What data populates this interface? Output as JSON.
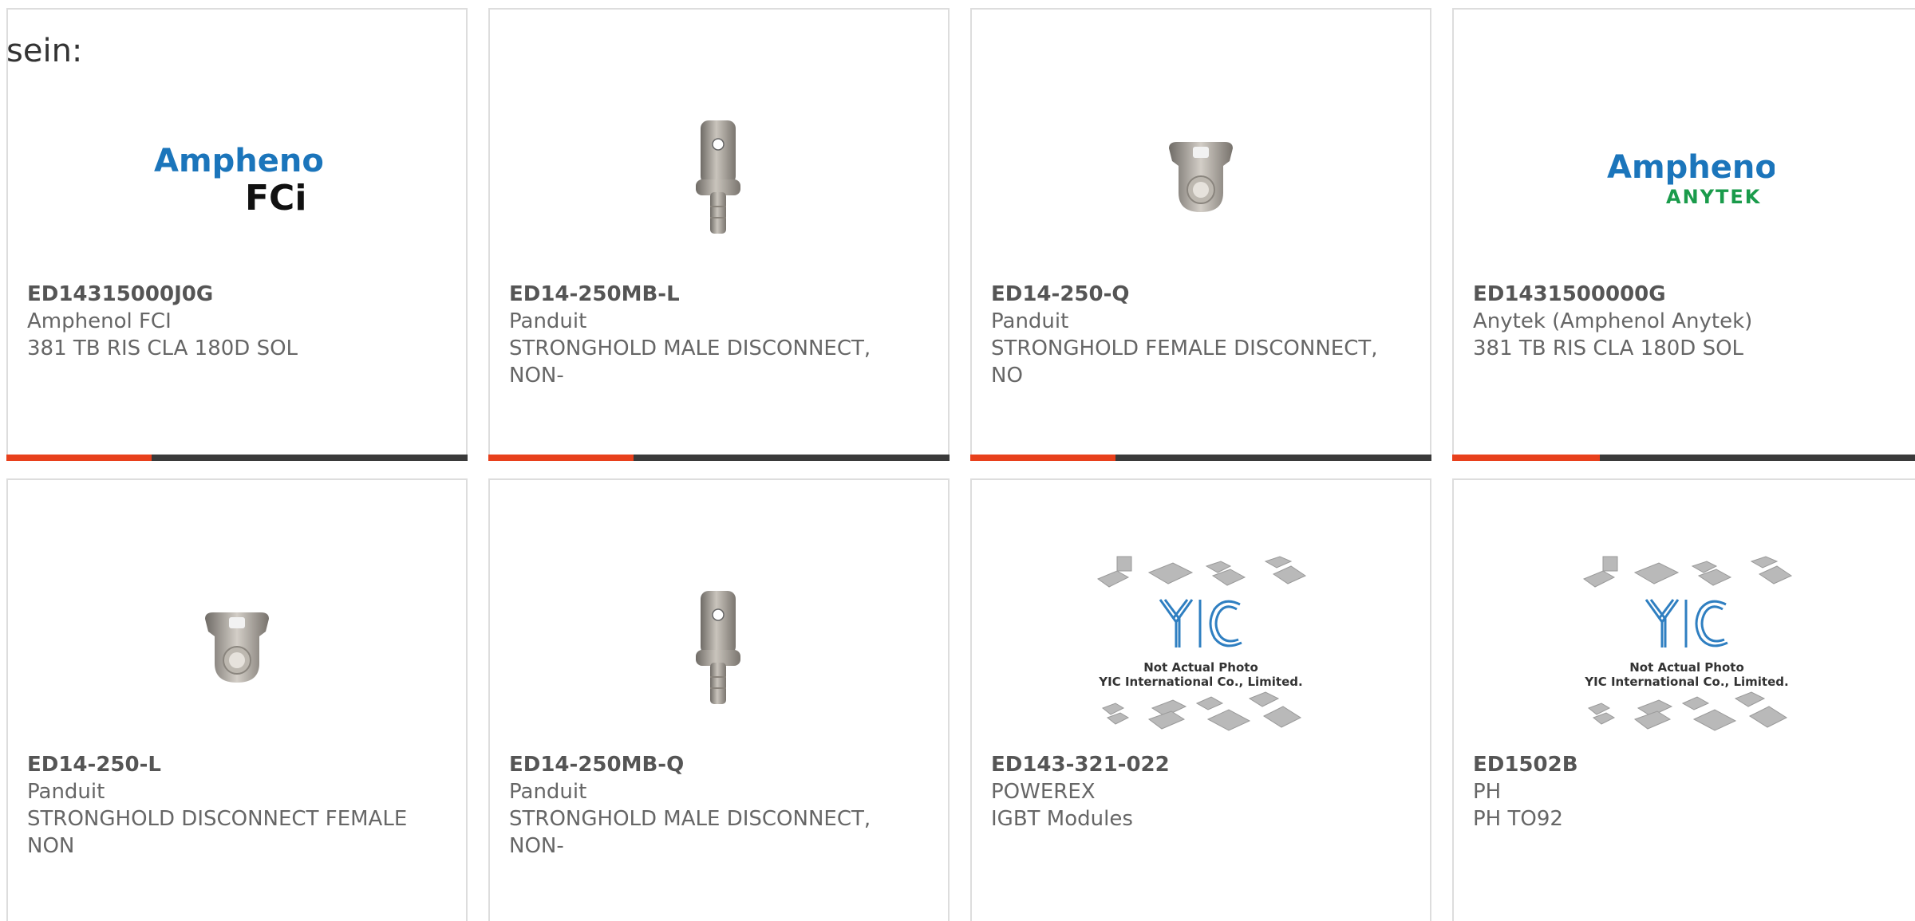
{
  "page": {
    "heading": "sein:"
  },
  "products": [
    {
      "part_number": "ED14315000J0G",
      "manufacturer": "Amphenol FCI",
      "description": "381 TB RIS CLA 180D SOL",
      "image": "amphenol-fci-logo",
      "logo_text_top": "Amphenol",
      "logo_text_bottom": "FCi"
    },
    {
      "part_number": "ED14-250MB-L",
      "manufacturer": "Panduit",
      "description": "STRONGHOLD MALE DISCONNECT, NON-",
      "image": "male-disconnect-terminal"
    },
    {
      "part_number": "ED14-250-Q",
      "manufacturer": "Panduit",
      "description": "STRONGHOLD FEMALE DISCONNECT, NO",
      "image": "female-disconnect-terminal"
    },
    {
      "part_number": "ED1431500000G",
      "manufacturer": "Anytek (Amphenol Anytek)",
      "description": "381 TB RIS CLA 180D SOL",
      "image": "amphenol-anytek-logo",
      "logo_text_top": "Amphenol",
      "logo_text_bottom": "ANYTEK"
    },
    {
      "part_number": "ED14-250-L",
      "manufacturer": "Panduit",
      "description": "STRONGHOLD DISCONNECT FEMALE NON",
      "image": "female-disconnect-terminal"
    },
    {
      "part_number": "ED14-250MB-Q",
      "manufacturer": "Panduit",
      "description": "STRONGHOLD MALE DISCONNECT, NON-",
      "image": "male-disconnect-terminal"
    },
    {
      "part_number": "ED143-321-022",
      "manufacturer": "POWEREX",
      "description": "IGBT Modules",
      "image": "yic-placeholder",
      "placeholder_line1": "Not Actual Photo",
      "placeholder_line2": "YIC International Co., Limited."
    },
    {
      "part_number": "ED1502B",
      "manufacturer": "PH",
      "description": "PH TO92",
      "image": "yic-placeholder",
      "placeholder_line1": "Not Actual Photo",
      "placeholder_line2": "YIC International Co., Limited."
    }
  ],
  "colors": {
    "accent": "#e8401c",
    "bar": "#3a3a3a",
    "text": "#666666",
    "amphenol_blue": "#1b75bb",
    "anytek_green": "#1a9b4b",
    "yic_blue": "#2f7fc1"
  }
}
